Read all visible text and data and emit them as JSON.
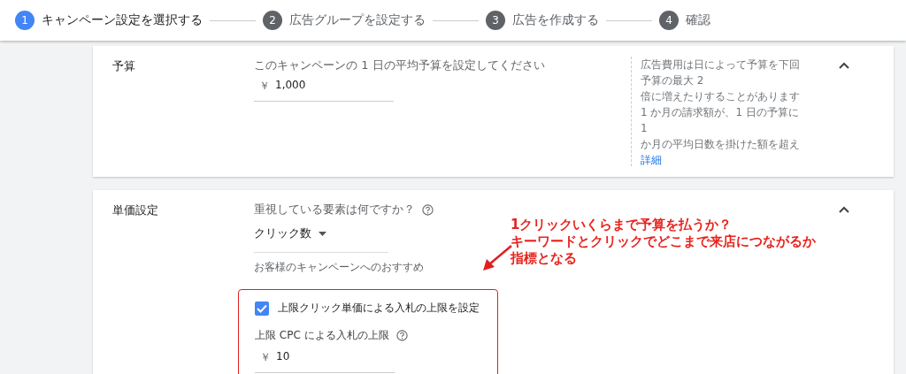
{
  "steps": [
    {
      "number": "1",
      "label": "キャンペーン設定を選択する",
      "selected": true
    },
    {
      "number": "2",
      "label": "広告グループを設定する",
      "selected": false
    },
    {
      "number": "3",
      "label": "広告を作成する",
      "selected": false
    },
    {
      "number": "4",
      "label": "確認",
      "selected": false
    }
  ],
  "budget": {
    "label": "予算",
    "prompt": "このキャンペーンの 1 日の平均予算を設定してください",
    "currency": "￥",
    "value": "1,000",
    "note_lines": [
      "広告費用は日によって予算を下回",
      "予算の最大 2",
      "倍に増えたりすることがあります",
      "1 か月の請求額が、1 日の予算に",
      "1",
      "か月の平均日数を掛けた額を超え"
    ],
    "details_link": "詳細"
  },
  "bidding": {
    "label": "単価設定",
    "question": "重視している要素は何ですか？",
    "dropdown_value": "クリック数",
    "recommendation": "お客様のキャンペーンへのおすすめ",
    "checkbox": {
      "label": "上限クリック単価による入札の上限を設定",
      "checked": true
    },
    "cpc_label": "上限 CPC による入札の上限",
    "currency": "￥",
    "cpc_value": "10"
  },
  "annotation": {
    "lines": [
      "1クリックいくらまで予算を払うか？",
      "キーワードとクリックでどこまで来店につながるか",
      "指標となる"
    ]
  }
}
